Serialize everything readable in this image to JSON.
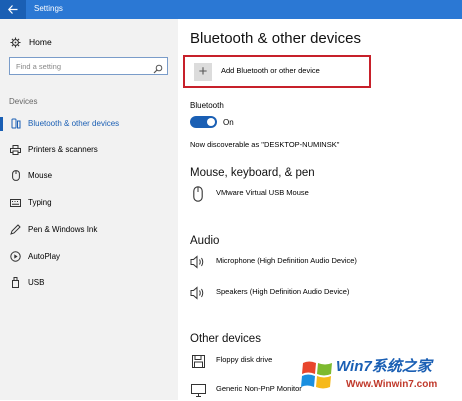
{
  "window": {
    "title": "Settings"
  },
  "sidebar": {
    "home_label": "Home",
    "search_placeholder": "Find a setting",
    "section_label": "Devices",
    "items": [
      {
        "label": "Bluetooth & other devices",
        "icon": "bluetooth-devices-icon",
        "active": true
      },
      {
        "label": "Printers & scanners",
        "icon": "printer-icon"
      },
      {
        "label": "Mouse",
        "icon": "mouse-icon"
      },
      {
        "label": "Typing",
        "icon": "keyboard-icon"
      },
      {
        "label": "Pen & Windows Ink",
        "icon": "pen-icon"
      },
      {
        "label": "AutoPlay",
        "icon": "autoplay-icon"
      },
      {
        "label": "USB",
        "icon": "usb-icon"
      }
    ]
  },
  "main": {
    "title": "Bluetooth & other devices",
    "add_device_label": "Add Bluetooth or other device",
    "bluetooth_label": "Bluetooth",
    "bluetooth_state": "On",
    "discoverable_text": "Now discoverable as \"DESKTOP-NUMINSK\"",
    "groups": [
      {
        "heading": "Mouse, keyboard, & pen",
        "devices": [
          {
            "name": "VMware Virtual USB Mouse",
            "icon": "mouse-icon"
          }
        ]
      },
      {
        "heading": "Audio",
        "devices": [
          {
            "name": "Microphone (High Definition Audio Device)",
            "icon": "speaker-icon"
          },
          {
            "name": "Speakers (High Definition Audio Device)",
            "icon": "speaker-icon"
          }
        ]
      },
      {
        "heading": "Other devices",
        "devices": [
          {
            "name": "Floppy disk drive",
            "icon": "floppy-disk-icon"
          },
          {
            "name": "Generic Non-PnP Monitor",
            "icon": "monitor-icon"
          }
        ]
      }
    ]
  },
  "watermark": {
    "brand": "Win7系统之家",
    "url": "Www.Winwin7.com"
  },
  "colors": {
    "accent": "#1a5fb4",
    "titlebar": "#2b78d4",
    "highlight_border": "#c7202a",
    "sidebar_bg": "#f2f2f2"
  }
}
